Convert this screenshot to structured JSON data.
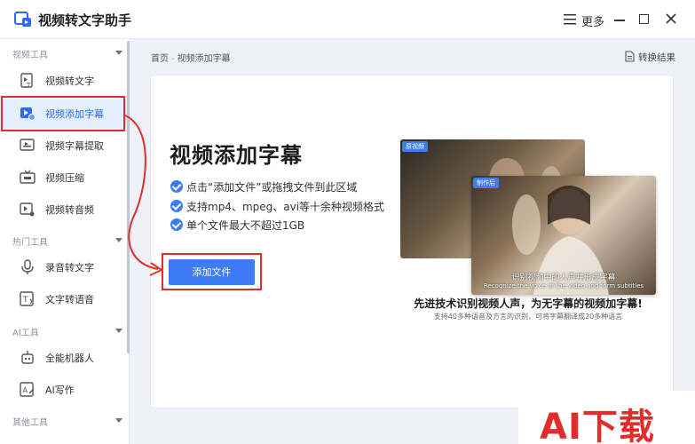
{
  "app": {
    "title": "视频转文字助手"
  },
  "titlebar": {
    "more_label": "更多"
  },
  "sidebar": {
    "sections": [
      {
        "label": "视频工具",
        "items": [
          {
            "label": "视频转文字",
            "icon": "video-doc-icon"
          },
          {
            "label": "视频添加字幕",
            "icon": "video-subtitle-icon",
            "active": true
          },
          {
            "label": "视频字幕提取",
            "icon": "subtitle-extract-icon"
          },
          {
            "label": "视频压缩",
            "icon": "tv-compress-icon"
          },
          {
            "label": "视频转音频",
            "icon": "video-audio-icon"
          }
        ]
      },
      {
        "label": "热门工具",
        "items": [
          {
            "label": "录音转文字",
            "icon": "microphone-icon"
          },
          {
            "label": "文字转语音",
            "icon": "text-speech-icon"
          }
        ]
      },
      {
        "label": "AI工具",
        "items": [
          {
            "label": "全能机器人",
            "icon": "robot-icon"
          },
          {
            "label": "AI写作",
            "icon": "ai-write-icon"
          }
        ]
      },
      {
        "label": "其他工具",
        "items": []
      }
    ]
  },
  "breadcrumb": {
    "home": "首页",
    "separator": "-",
    "current": "视频添加字幕"
  },
  "header": {
    "results_label": "转换结果"
  },
  "main": {
    "title": "视频添加字幕",
    "features": [
      "点击“添加文件”或拖拽文件到此区域",
      "支持mp4、mpeg、avi等十余种视频格式",
      "单个文件最大不超过1GB"
    ],
    "add_button": "添加文件",
    "preview": {
      "before_tag": "原视频",
      "after_tag": "制作后",
      "subtitle_cn": "识别视频中的人声并形成字幕",
      "subtitle_en": "Recognize the voice of the video and form subtitles",
      "promo_title": "先进技术识别视频人声，为无字幕的视频加字幕!",
      "promo_sub": "支持40多种语音及方言的识别，可将字幕翻译成20多种语言"
    }
  },
  "watermark": {
    "text": "AI下载"
  },
  "colors": {
    "accent": "#3d7cf5",
    "highlight": "#e32c2c",
    "active_bg": "#e4efff"
  }
}
